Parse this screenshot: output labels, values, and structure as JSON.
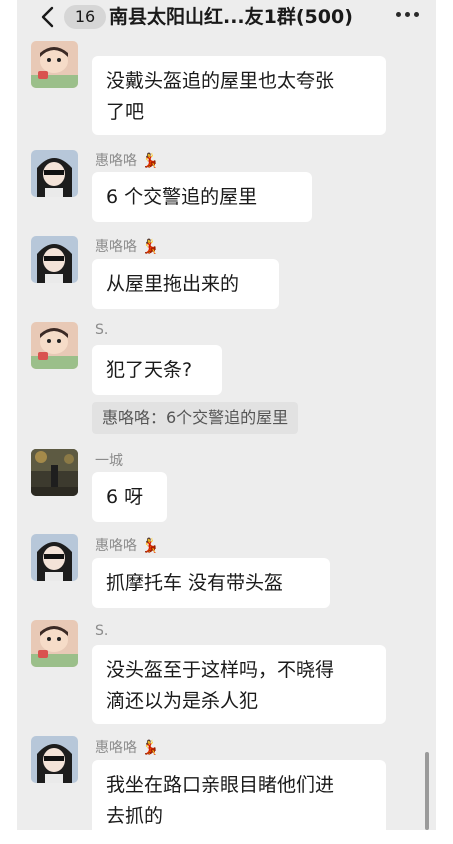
{
  "header": {
    "unread_count": "16",
    "title": "南县太阳山红...友1群(500)"
  },
  "messages": [
    {
      "sender": "",
      "text_lines": [
        "没戴头盔追的屋里也太夸张",
        "了吧"
      ]
    },
    {
      "sender": "惠咯咯",
      "text_lines": [
        "6 个交警追的屋里"
      ]
    },
    {
      "sender": "惠咯咯",
      "text_lines": [
        "从屋里拖出来的"
      ]
    },
    {
      "sender": "S.",
      "text_lines": [
        "犯了天条?"
      ],
      "quote": "惠咯咯：6个交警追的屋里"
    },
    {
      "sender": "一城",
      "text_lines": [
        "6 呀"
      ]
    },
    {
      "sender": "惠咯咯",
      "text_lines": [
        "抓摩托车 没有带头盔"
      ]
    },
    {
      "sender": "S.",
      "text_lines": [
        "没头盔至于这样吗，不晓得",
        "滴还以为是杀人犯"
      ]
    },
    {
      "sender": "惠咯咯",
      "text_lines": [
        "我坐在路口亲眼目睹他们进",
        "去抓的"
      ]
    }
  ],
  "icons": {
    "back": "chevron-left-icon",
    "more": "more-dots-icon",
    "nick_emoji": "dancer-emoji-icon",
    "avatar_styles": [
      "cartoon-boy",
      "anime-girl",
      "street-night-photo"
    ]
  },
  "colors": {
    "background": "#ededed",
    "bubble": "#ffffff",
    "quote": "#e2e2e2",
    "nickname": "#8c8c8c"
  }
}
